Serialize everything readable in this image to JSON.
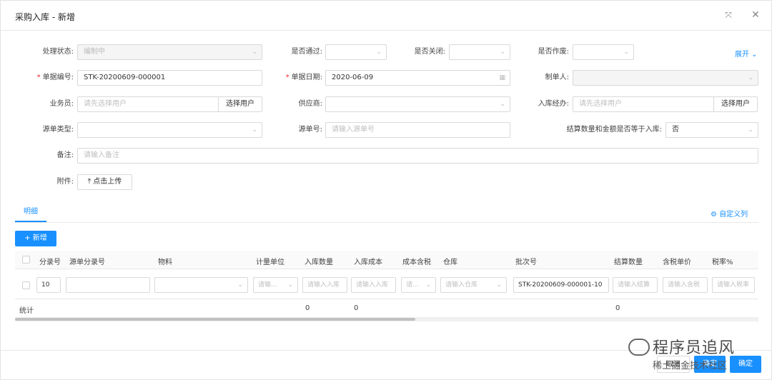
{
  "header": {
    "title": "采购入库 - 新增"
  },
  "form": {
    "status_label": "处理状态:",
    "status_value": "编制中",
    "passed_label": "是否通过:",
    "closed_label": "是否关闭:",
    "void_label": "是否作废:",
    "expand_label": "展开",
    "doc_no_label": "单据编号:",
    "doc_no_value": "STK-20200609-000001",
    "doc_date_label": "单据日期:",
    "doc_date_value": "2020-06-09",
    "creator_label": "制单人:",
    "salesman_label": "业务员:",
    "salesman_placeholder": "请先选择用户",
    "select_user_label": "选择用户",
    "supplier_label": "供应商:",
    "handler_label": "入库经办:",
    "handler_placeholder": "请先选择用户",
    "source_type_label": "源单类型:",
    "source_no_label": "源单号:",
    "source_no_placeholder": "请输入源单号",
    "settle_label": "结算数量和金额是否等于入库:",
    "settle_value": "否",
    "remark_label": "备注:",
    "remark_placeholder": "请输入备注",
    "attach_label": "附件:",
    "upload_label": "点击上传"
  },
  "tabs": {
    "detail": "明细",
    "custom_cols": "自定义列"
  },
  "toolbar": {
    "add_label": "新增"
  },
  "table": {
    "headers": [
      "分录号",
      "源单分录号",
      "物料",
      "计量单位",
      "入库数量",
      "入库成本",
      "成本含税",
      "仓库",
      "批次号",
      "结算数量",
      "含税单价",
      "税率%"
    ],
    "row": {
      "seq": "10",
      "unit_ph": "请输...",
      "qty_ph": "请输入入库",
      "cost_ph": "请输入入库",
      "tax_ph": "请...",
      "wh_ph": "请输入仓库",
      "batch": "STK-20200609-000001-10",
      "settle_ph": "请输入结算",
      "price_ph": "请输入含税",
      "rate_ph": "请输入税率"
    },
    "summary": {
      "label": "统计",
      "qty": "0",
      "cost": "0",
      "settle": "0"
    }
  },
  "footer": {
    "cancel": "取消",
    "confirm": "确定"
  },
  "watermark": {
    "line1": "程序员追风",
    "line2": "稀土掘金技术社区"
  }
}
